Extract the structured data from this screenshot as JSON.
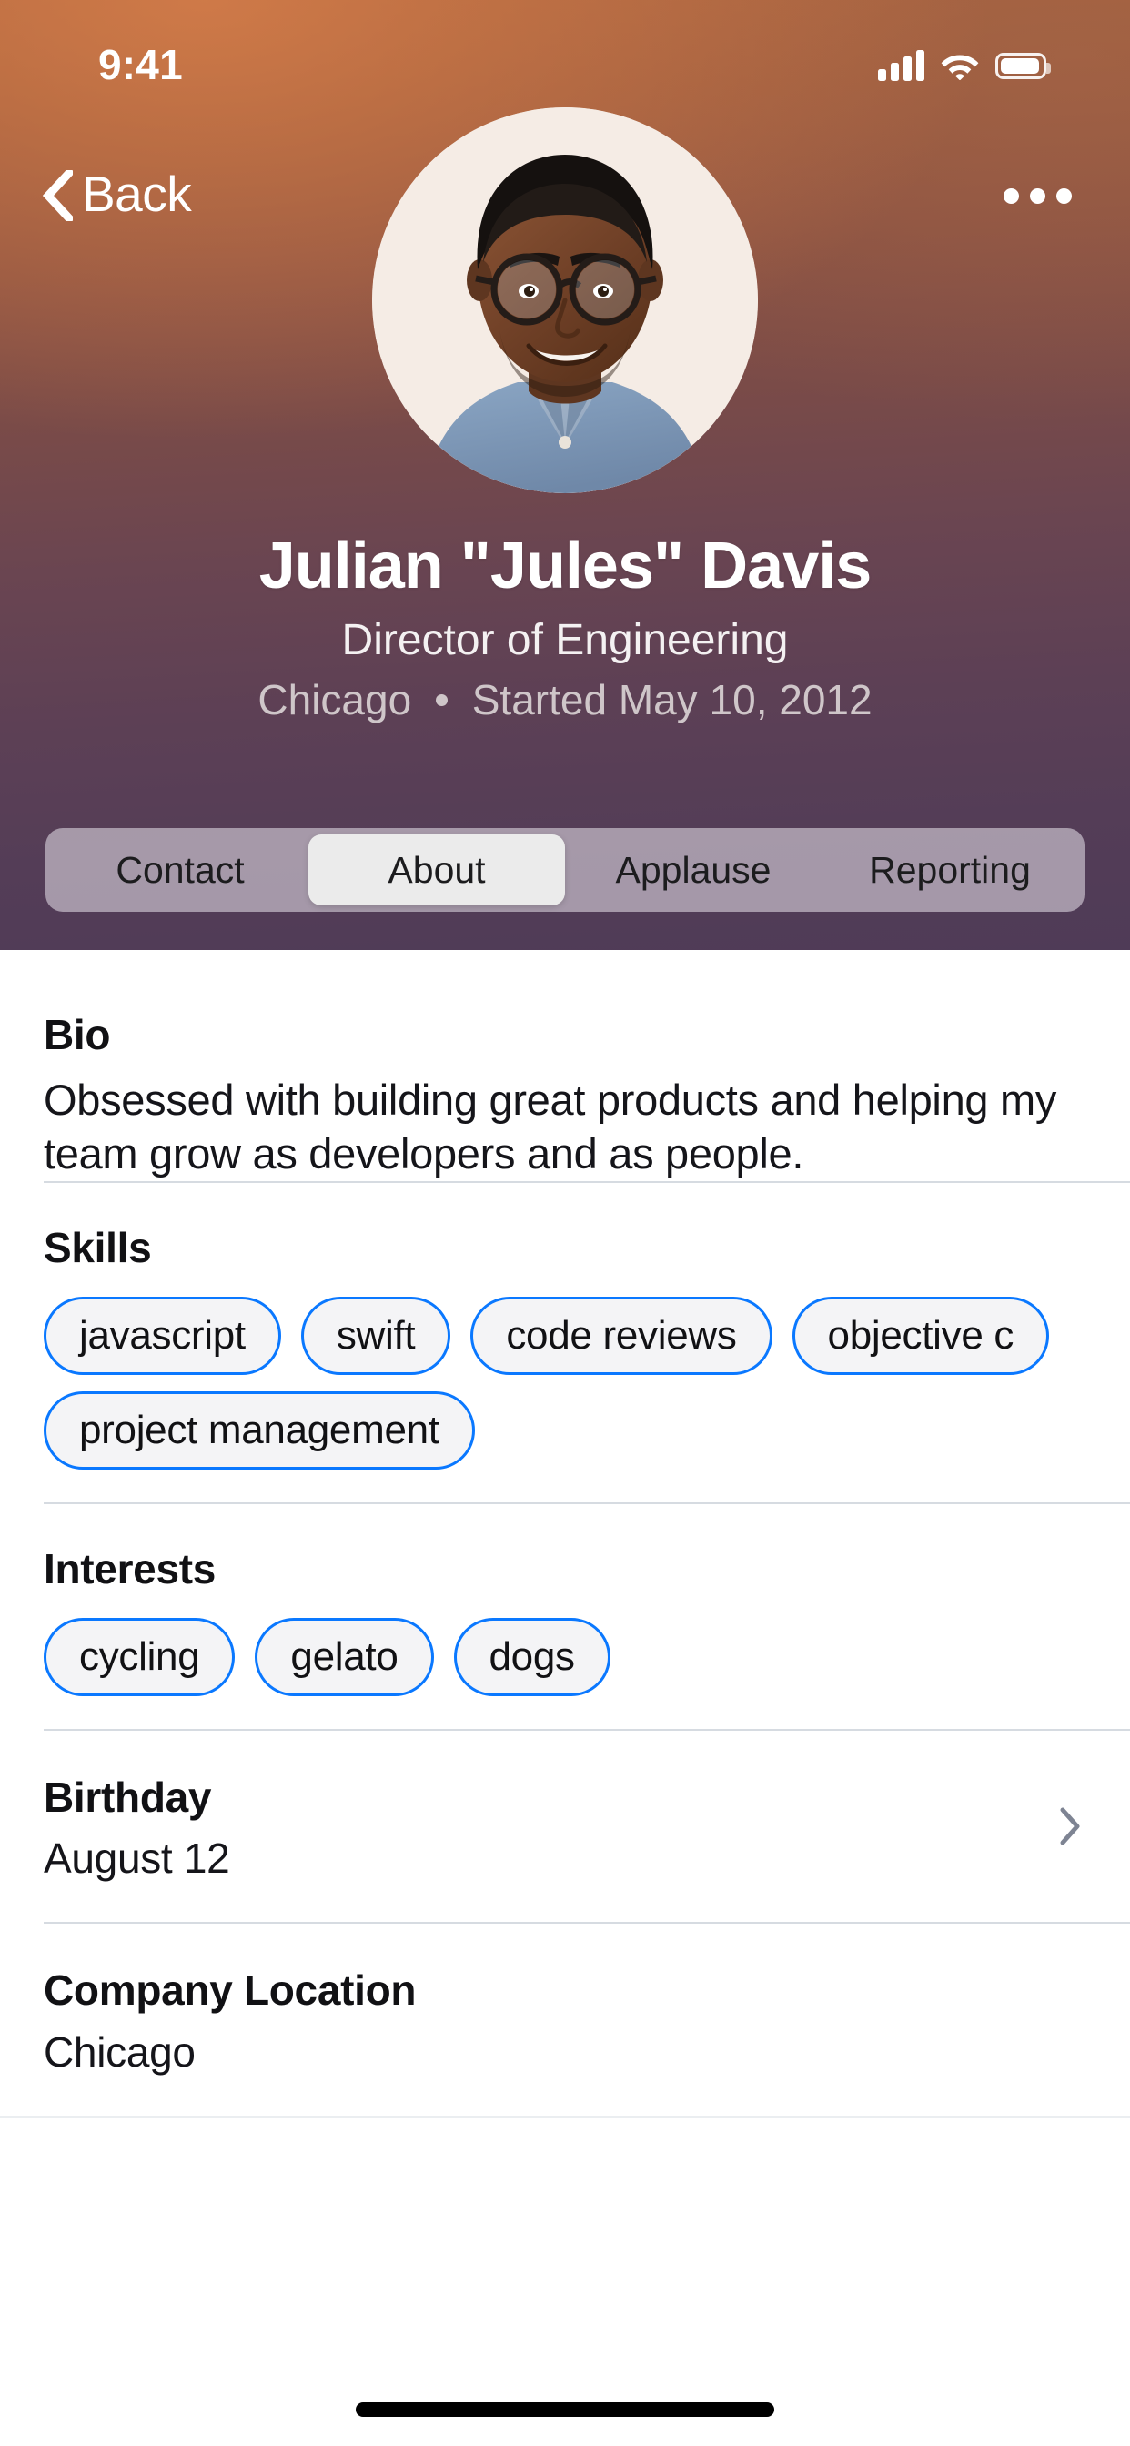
{
  "status_bar": {
    "time": "9:41",
    "icons": [
      "cellular-signal-icon",
      "wifi-icon",
      "battery-icon"
    ]
  },
  "nav": {
    "back_label": "Back",
    "back_icon": "chevron-left-icon",
    "more_icon": "more-horizontal-icon"
  },
  "profile": {
    "avatar_alt": "Julian Davis profile photo",
    "name": "Julian \"Jules\" Davis",
    "title": "Director of Engineering",
    "location": "Chicago",
    "start_info": "Started May 10, 2012"
  },
  "tabs": {
    "selected": "About",
    "items": [
      {
        "label": "Contact"
      },
      {
        "label": "About"
      },
      {
        "label": "Applause"
      },
      {
        "label": "Reporting"
      }
    ]
  },
  "sections": {
    "bio": {
      "heading": "Bio",
      "text": "Obsessed with building great products and helping my team grow as developers and as people."
    },
    "skills": {
      "heading": "Skills",
      "items": [
        {
          "label": "javascript"
        },
        {
          "label": "swift"
        },
        {
          "label": "code reviews"
        },
        {
          "label": "objective c"
        },
        {
          "label": "project management"
        }
      ]
    },
    "interests": {
      "heading": "Interests",
      "items": [
        {
          "label": "cycling"
        },
        {
          "label": "gelato"
        },
        {
          "label": "dogs"
        }
      ]
    },
    "birthday": {
      "label": "Birthday",
      "value": "August 12",
      "chevron_icon": "chevron-right-icon"
    },
    "company_location": {
      "label": "Company Location",
      "value": "Chicago"
    }
  },
  "colors": {
    "accent_blue": "#0a78ff",
    "header_gradient_top": "#a6613d",
    "header_gradient_bottom": "#4f3b57",
    "chip_fill": "#f4f4f6",
    "segment_active": "#ebebeb"
  }
}
